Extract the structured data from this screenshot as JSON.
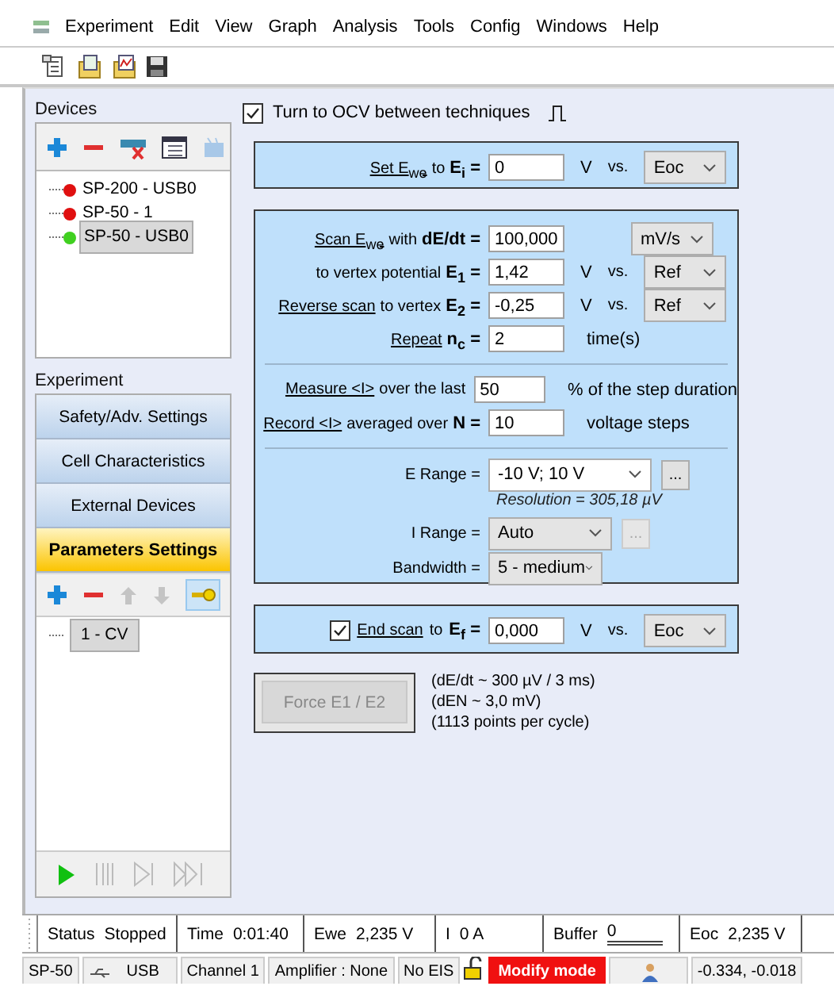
{
  "menu": [
    "Experiment",
    "Edit",
    "View",
    "Graph",
    "Analysis",
    "Tools",
    "Config",
    "Windows",
    "Help"
  ],
  "ocv": {
    "label": "Turn to OCV between techniques",
    "checked": true
  },
  "devices": {
    "title": "Devices",
    "items": [
      {
        "label": "SP-200 - USB0",
        "color": "#e01010",
        "selected": false
      },
      {
        "label": "SP-50 - 1",
        "color": "#e01010",
        "selected": false
      },
      {
        "label": "SP-50 - USB0",
        "color": "#40d020",
        "selected": true
      }
    ]
  },
  "experiment": {
    "title": "Experiment",
    "buttons": [
      {
        "label": "Safety/Adv. Settings",
        "selected": false
      },
      {
        "label": "Cell Characteristics",
        "selected": false
      },
      {
        "label": "External Devices",
        "selected": false
      },
      {
        "label": "Parameters Settings",
        "selected": true
      }
    ],
    "techniques": [
      {
        "label": "1 - CV",
        "selected": true
      }
    ]
  },
  "set_panel": {
    "link": "Set E$_{we}$",
    "label": "to",
    "symbol": "E$_{i}$ =",
    "value": "0",
    "unit": "V",
    "vs": "vs.",
    "reference": "Eoc"
  },
  "scan_panel": {
    "groups": [
      [
        {
          "link": "Scan E$_{we}$",
          "label": "with",
          "symbol": "dE/dt =",
          "value": "100,000",
          "reference": "mV/s"
        },
        {
          "label": "to vertex potential",
          "symbol": "E$_{1}$ =",
          "value": "1,42",
          "unit": "V",
          "vs": "vs.",
          "reference": "Ref"
        },
        {
          "link": "Reverse scan",
          "label": "to vertex",
          "symbol": "E$_{2}$ =",
          "value": "-0,25",
          "unit": "V",
          "vs": "vs.",
          "reference": "Ref"
        },
        {
          "link": "Repeat",
          "symbol": "n$_{c}$ =",
          "value": "2",
          "unit": "time(s)"
        }
      ],
      [
        {
          "link": "Measure <I>",
          "label": "over the last",
          "value": "50",
          "unit": "% of the step duration"
        },
        {
          "link": "Record <I>",
          "label": "averaged over",
          "symbol": "N =",
          "value": "10",
          "unit": "voltage steps"
        }
      ]
    ],
    "e_range": {
      "label": "E Range =",
      "value": "-10 V; 10 V",
      "more": "...",
      "disabled": false,
      "note": "Resolution = 305,18 µV"
    },
    "i_range": {
      "label": "I Range =",
      "value": "Auto",
      "more": "...",
      "disabled": true
    },
    "bandwidth": {
      "label": "Bandwidth =",
      "value": "5 - medium"
    }
  },
  "end_panel": {
    "checked": true,
    "link": "End scan",
    "label": "to",
    "symbol": "E$_{f}$ =",
    "value": "0,000",
    "unit": "V",
    "vs": "vs.",
    "reference": "Eoc"
  },
  "force_button": {
    "label": "Force E1 / E2",
    "disabled": true
  },
  "notes": [
    "(dE/dt ~ 300 µV / 3 ms)",
    "(dEN ~ 3,0 mV)",
    "(1113 points per cycle)"
  ],
  "status_bar": [
    {
      "label": "Status",
      "value": "Stopped"
    },
    {
      "label": "Time",
      "value": "0:01:40"
    },
    {
      "label": "Ewe",
      "value": "2,235 V"
    },
    {
      "label": "I",
      "value": "0 A"
    },
    {
      "label": "Buffer",
      "value": "0"
    },
    {
      "label": "Eoc",
      "value": "2,235 V"
    }
  ],
  "bottom_bar": [
    {
      "kind": "text",
      "label": "SP-50"
    },
    {
      "kind": "usb",
      "label": "USB"
    },
    {
      "kind": "text",
      "label": "Channel 1"
    },
    {
      "kind": "text",
      "label": "Amplifier : None"
    },
    {
      "kind": "text",
      "label": "No EIS"
    },
    {
      "kind": "lock"
    },
    {
      "kind": "alert",
      "label": "Modify mode"
    },
    {
      "kind": "user"
    },
    {
      "kind": "text",
      "label": "-0.334, -0.018"
    }
  ]
}
